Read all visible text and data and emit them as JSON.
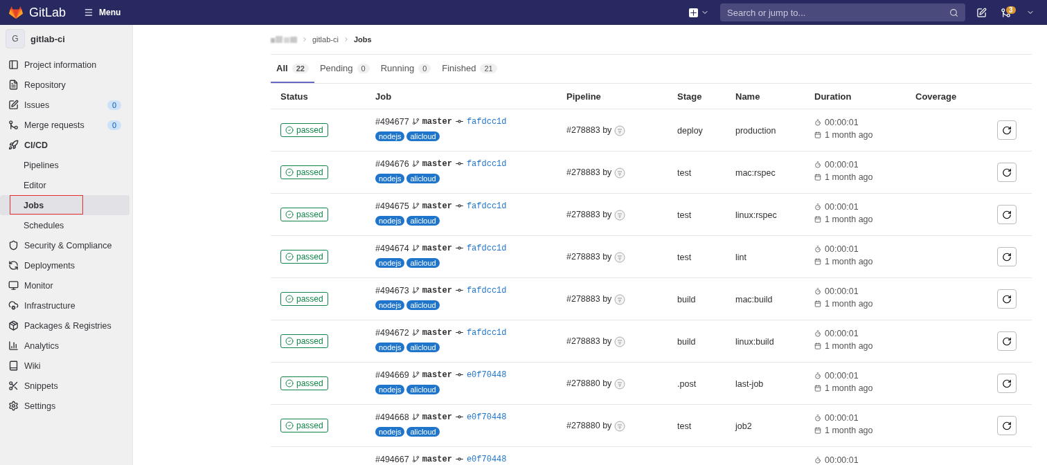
{
  "topbar": {
    "brand": "GitLab",
    "menu": "Menu",
    "search": {
      "placeholder": "Search or jump to..."
    },
    "merge_requests_count": "3"
  },
  "sidebar": {
    "project": {
      "avatar": "G",
      "name": "gitlab-ci"
    },
    "items": [
      {
        "label": "Project information",
        "selected": false
      },
      {
        "label": "Repository",
        "selected": false
      },
      {
        "label": "Issues",
        "count": "0",
        "selected": false
      },
      {
        "label": "Merge requests",
        "count": "0",
        "selected": false
      },
      {
        "label": "CI/CD",
        "selected": false,
        "expanded": true,
        "children": [
          {
            "label": "Pipelines",
            "selected": false
          },
          {
            "label": "Editor",
            "selected": false
          },
          {
            "label": "Jobs",
            "selected": true,
            "highlighted": true
          },
          {
            "label": "Schedules",
            "selected": false
          }
        ]
      },
      {
        "label": "Security & Compliance",
        "selected": false
      },
      {
        "label": "Deployments",
        "selected": false
      },
      {
        "label": "Monitor",
        "selected": false
      },
      {
        "label": "Infrastructure",
        "selected": false
      },
      {
        "label": "Packages & Registries",
        "selected": false
      },
      {
        "label": "Analytics",
        "selected": false
      },
      {
        "label": "Wiki",
        "selected": false
      },
      {
        "label": "Snippets",
        "selected": false
      },
      {
        "label": "Settings",
        "selected": false
      }
    ]
  },
  "breadcrumb": [
    "gitlab-ci",
    "Jobs"
  ],
  "tabs": [
    {
      "label": "All",
      "count": "22",
      "selected": true
    },
    {
      "label": "Pending",
      "count": "0",
      "selected": false
    },
    {
      "label": "Running",
      "count": "0",
      "selected": false
    },
    {
      "label": "Finished",
      "count": "21",
      "selected": false
    }
  ],
  "table": {
    "columns": [
      "Status",
      "Job",
      "Pipeline",
      "Stage",
      "Name",
      "Duration",
      "Coverage"
    ],
    "rows": [
      {
        "status": "passed",
        "job": "#494677",
        "branch": "master",
        "commit": "fafdcc1d",
        "tags": [
          "nodejs",
          "alicloud"
        ],
        "pipeline": "#278883 by",
        "stage": "deploy",
        "name": "production",
        "duration": "00:00:01",
        "finished": "1 month ago"
      },
      {
        "status": "passed",
        "job": "#494676",
        "branch": "master",
        "commit": "fafdcc1d",
        "tags": [
          "nodejs",
          "alicloud"
        ],
        "pipeline": "#278883 by",
        "stage": "test",
        "name": "mac:rspec",
        "duration": "00:00:01",
        "finished": "1 month ago"
      },
      {
        "status": "passed",
        "job": "#494675",
        "branch": "master",
        "commit": "fafdcc1d",
        "tags": [
          "nodejs",
          "alicloud"
        ],
        "pipeline": "#278883 by",
        "stage": "test",
        "name": "linux:rspec",
        "duration": "00:00:01",
        "finished": "1 month ago"
      },
      {
        "status": "passed",
        "job": "#494674",
        "branch": "master",
        "commit": "fafdcc1d",
        "tags": [
          "nodejs",
          "alicloud"
        ],
        "pipeline": "#278883 by",
        "stage": "test",
        "name": "lint",
        "duration": "00:00:01",
        "finished": "1 month ago"
      },
      {
        "status": "passed",
        "job": "#494673",
        "branch": "master",
        "commit": "fafdcc1d",
        "tags": [
          "nodejs",
          "alicloud"
        ],
        "pipeline": "#278883 by",
        "stage": "build",
        "name": "mac:build",
        "duration": "00:00:01",
        "finished": "1 month ago"
      },
      {
        "status": "passed",
        "job": "#494672",
        "branch": "master",
        "commit": "fafdcc1d",
        "tags": [
          "nodejs",
          "alicloud"
        ],
        "pipeline": "#278883 by",
        "stage": "build",
        "name": "linux:build",
        "duration": "00:00:01",
        "finished": "1 month ago"
      },
      {
        "status": "passed",
        "job": "#494669",
        "branch": "master",
        "commit": "e0f70448",
        "tags": [
          "nodejs",
          "alicloud"
        ],
        "pipeline": "#278880 by",
        "stage": ".post",
        "name": "last-job",
        "duration": "00:00:01",
        "finished": "1 month ago"
      },
      {
        "status": "passed",
        "job": "#494668",
        "branch": "master",
        "commit": "e0f70448",
        "tags": [
          "nodejs",
          "alicloud"
        ],
        "pipeline": "#278880 by",
        "stage": "test",
        "name": "job2",
        "duration": "00:00:01",
        "finished": "1 month ago"
      },
      {
        "job": "#494667",
        "branch": "master",
        "commit": "e0f70448",
        "duration": "00:00:01"
      }
    ]
  }
}
